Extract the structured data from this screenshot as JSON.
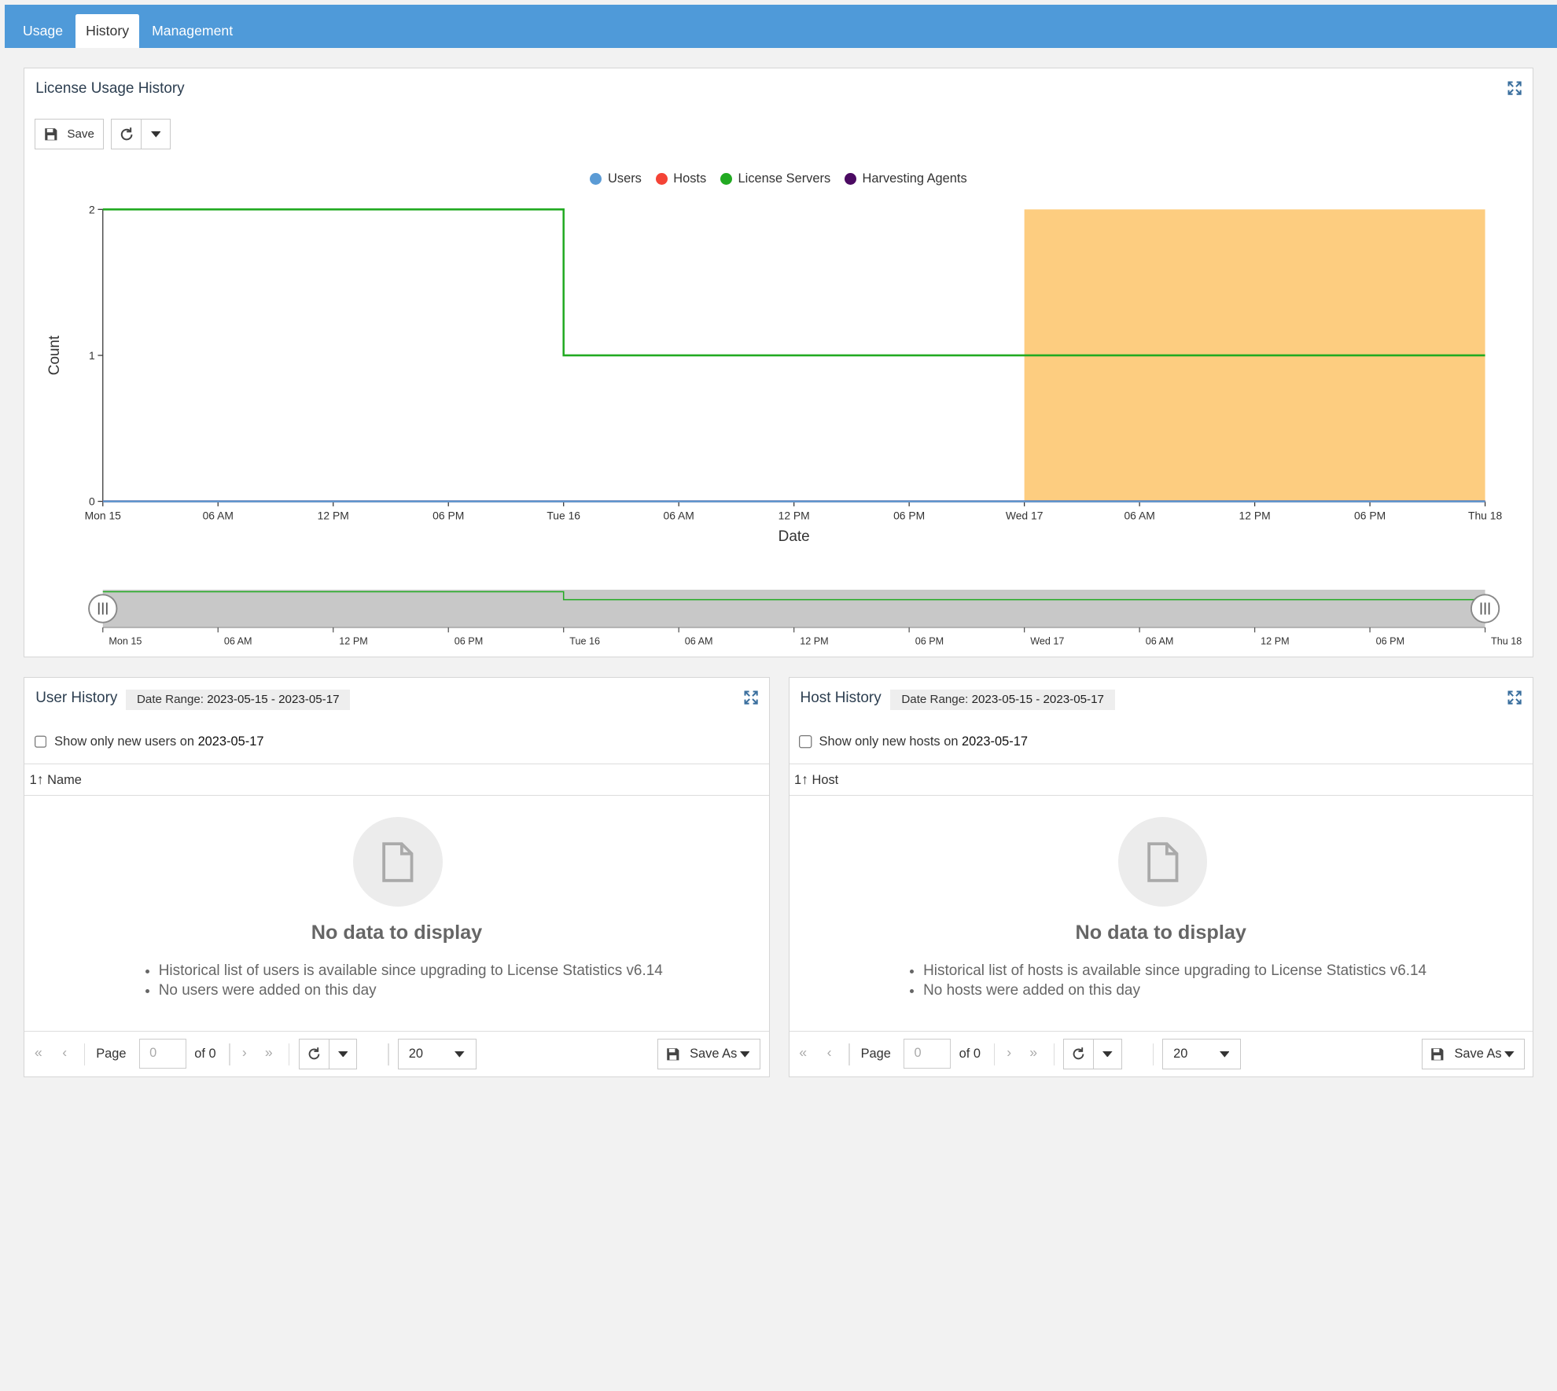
{
  "tabs": [
    {
      "label": "Usage",
      "active": false
    },
    {
      "label": "History",
      "active": true
    },
    {
      "label": "Management",
      "active": false
    }
  ],
  "license_panel": {
    "title": "License Usage History",
    "save_label": "Save",
    "refresh_icon": "refresh-icon",
    "dropdown_icon": "caret-down-icon",
    "expand_icon": "expand-icon"
  },
  "chart_data": {
    "type": "line",
    "title": "",
    "xlabel": "Date",
    "ylabel": "Count",
    "ylim": [
      0,
      2
    ],
    "yticks": [
      0,
      1,
      2
    ],
    "xticks": [
      "Mon 15",
      "06 AM",
      "12 PM",
      "06 PM",
      "Tue 16",
      "06 AM",
      "12 PM",
      "06 PM",
      "Wed 17",
      "06 AM",
      "12 PM",
      "06 PM",
      "Thu 18"
    ],
    "xlim": [
      "2023-05-15 00:00",
      "2023-05-18 00:00"
    ],
    "legend_position": "top-center",
    "series": [
      {
        "name": "Users",
        "color": "#5b9bd5",
        "x": [
          "2023-05-15 00:00",
          "2023-05-18 00:00"
        ],
        "y": [
          0,
          0
        ]
      },
      {
        "name": "Hosts",
        "color": "#f44336",
        "x": [
          "2023-05-15 00:00",
          "2023-05-18 00:00"
        ],
        "y": [
          0,
          0
        ]
      },
      {
        "name": "License Servers",
        "color": "#22aa22",
        "step": true,
        "x": [
          "2023-05-15 00:00",
          "2023-05-16 00:00",
          "2023-05-18 00:00"
        ],
        "y": [
          2,
          1,
          1
        ]
      },
      {
        "name": "Harvesting Agents",
        "color": "#4b0a62",
        "x": [
          "2023-05-15 00:00",
          "2023-05-18 00:00"
        ],
        "y": [
          0,
          0
        ]
      }
    ],
    "highlight": {
      "x_start": "2023-05-17 00:00",
      "x_end": "2023-05-18 00:00",
      "color": "#fdcd80"
    },
    "navigator": {
      "xticks": [
        "Mon 15",
        "06 AM",
        "12 PM",
        "06 PM",
        "Tue 16",
        "06 AM",
        "12 PM",
        "06 PM",
        "Wed 17",
        "06 AM",
        "12 PM",
        "06 PM",
        "Thu 18"
      ]
    }
  },
  "user_panel": {
    "title": "User History",
    "date_range_label": "Date Range:",
    "date_range_value": "2023-05-15 - 2023-05-17",
    "checkbox_label": "Show only new users on",
    "checkbox_date": "2023-05-17",
    "column_sort": "1",
    "column_header": "Name",
    "empty_title": "No data to display",
    "empty_items": [
      "Historical list of users is available since upgrading to License Statistics v6.14",
      "No users were added on this day"
    ],
    "page_label": "Page",
    "page_value": "0",
    "of_label": "of 0",
    "page_size": "20",
    "save_as": "Save As"
  },
  "host_panel": {
    "title": "Host History",
    "date_range_label": "Date Range:",
    "date_range_value": "2023-05-15 - 2023-05-17",
    "checkbox_label": "Show only new hosts on",
    "checkbox_date": "2023-05-17",
    "column_sort": "1",
    "column_header": "Host",
    "empty_title": "No data to display",
    "empty_items": [
      "Historical list of hosts is available since upgrading to License Statistics v6.14",
      "No hosts were added on this day"
    ],
    "page_label": "Page",
    "page_value": "0",
    "of_label": "of 0",
    "page_size": "20",
    "save_as": "Save As"
  }
}
